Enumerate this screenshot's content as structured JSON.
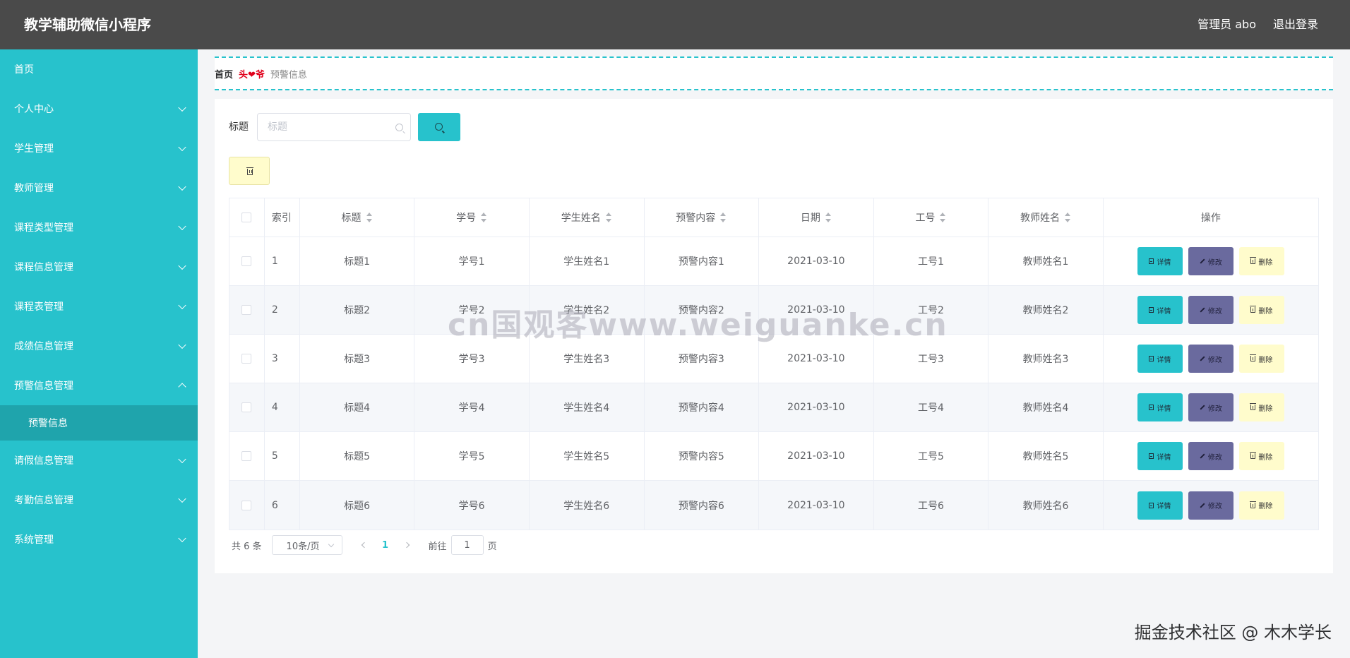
{
  "header": {
    "app_title": "教学辅助微信小程序",
    "user_label": "管理员 abo",
    "logout_label": "退出登录"
  },
  "sidebar": {
    "items": [
      {
        "label": "首页"
      },
      {
        "label": "个人中心"
      },
      {
        "label": "学生管理"
      },
      {
        "label": "教师管理"
      },
      {
        "label": "课程类型管理"
      },
      {
        "label": "课程信息管理"
      },
      {
        "label": "课程表管理"
      },
      {
        "label": "成绩信息管理"
      },
      {
        "label": "预警信息管理",
        "expanded": true
      },
      {
        "label": "请假信息管理"
      },
      {
        "label": "考勤信息管理"
      },
      {
        "label": "系统管理"
      }
    ],
    "active_sub_item": "预警信息"
  },
  "breadcrumb": {
    "home": "首页",
    "separator": "头❤爷",
    "current": "预警信息"
  },
  "search": {
    "label": "标题",
    "placeholder": "标题"
  },
  "table": {
    "headers": {
      "index": "索引",
      "title": "标题",
      "student_no": "学号",
      "student_name": "学生姓名",
      "content": "预警内容",
      "date": "日期",
      "staff_no": "工号",
      "teacher_name": "教师姓名",
      "ops": "操作"
    },
    "rows": [
      {
        "index": "1",
        "title": "标题1",
        "student_no": "学号1",
        "student_name": "学生姓名1",
        "content": "预警内容1",
        "date": "2021-03-10",
        "staff_no": "工号1",
        "teacher_name": "教师姓名1"
      },
      {
        "index": "2",
        "title": "标题2",
        "student_no": "学号2",
        "student_name": "学生姓名2",
        "content": "预警内容2",
        "date": "2021-03-10",
        "staff_no": "工号2",
        "teacher_name": "教师姓名2"
      },
      {
        "index": "3",
        "title": "标题3",
        "student_no": "学号3",
        "student_name": "学生姓名3",
        "content": "预警内容3",
        "date": "2021-03-10",
        "staff_no": "工号3",
        "teacher_name": "教师姓名3"
      },
      {
        "index": "4",
        "title": "标题4",
        "student_no": "学号4",
        "student_name": "学生姓名4",
        "content": "预警内容4",
        "date": "2021-03-10",
        "staff_no": "工号4",
        "teacher_name": "教师姓名4"
      },
      {
        "index": "5",
        "title": "标题5",
        "student_no": "学号5",
        "student_name": "学生姓名5",
        "content": "预警内容5",
        "date": "2021-03-10",
        "staff_no": "工号5",
        "teacher_name": "教师姓名5"
      },
      {
        "index": "6",
        "title": "标题6",
        "student_no": "学号6",
        "student_name": "学生姓名6",
        "content": "预警内容6",
        "date": "2021-03-10",
        "staff_no": "工号6",
        "teacher_name": "教师姓名6"
      }
    ],
    "op_labels": {
      "detail": "详情",
      "edit": "修改",
      "delete": "删除"
    }
  },
  "pagination": {
    "total_text": "共 6 条",
    "page_size": "10条/页",
    "current_page": "1",
    "goto_label": "前往",
    "goto_value": "1",
    "page_unit": "页"
  },
  "overlays": {
    "watermark": "cn国观客www.weiguanke.cn",
    "credit": "掘金技术社区 @ 木木学长"
  },
  "colors": {
    "accent": "#27c2cc",
    "header_bg": "#4a4a4a",
    "edit_button": "#6a6a9e",
    "delete_button": "#fffccc"
  }
}
